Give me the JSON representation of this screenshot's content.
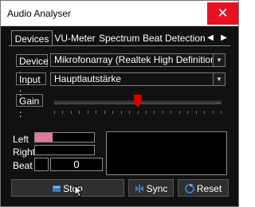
{
  "window": {
    "title": "Audio Analyser",
    "close_glyph": "✕"
  },
  "tabs": {
    "items": [
      {
        "label": "Devices"
      },
      {
        "label": "VU-Meter"
      },
      {
        "label": "Spectrum"
      },
      {
        "label": "Beat Detection"
      }
    ],
    "active": "Devices",
    "prev_glyph": "◀",
    "next_glyph": "▶"
  },
  "device": {
    "label": "Device :",
    "value": "Mikrofonarray (Realtek High Definition Audio)",
    "arrow_glyph": "▼"
  },
  "input": {
    "label": "Input :",
    "value": "Hauptlautstärke",
    "arrow_glyph": "▼"
  },
  "gain": {
    "label": "Gain :",
    "level_fraction": 0.5
  },
  "meters": {
    "left_label": "Left",
    "right_label": "Right",
    "beat_label": "Beat",
    "left_level_fraction": 0.3,
    "right_level_fraction": 0.0,
    "beat_count": "0"
  },
  "buttons": {
    "stop_label": "Stop",
    "sync_label": "Sync",
    "reset_label": "Reset"
  },
  "colors": {
    "meter_fill": "#e07a9a",
    "gain_thumb": "#d40000",
    "close_bg": "#e81123",
    "stop_icon": "#3a78c8",
    "sync_icon": "#3a78c8",
    "reset_icon": "#3a78c8"
  },
  "icons": {
    "stop": "stop-square-icon",
    "sync": "sync-arrows-icon",
    "reset": "reset-circle-icon",
    "cursor": "mouse-pointer-icon"
  }
}
